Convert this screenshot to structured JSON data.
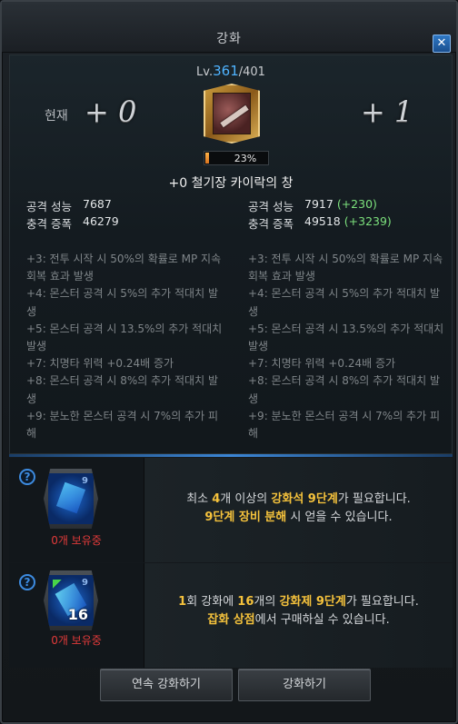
{
  "window": {
    "title": "강화"
  },
  "level": {
    "prefix": "Lv.",
    "current": "361",
    "max": "/401"
  },
  "current_label": "현재",
  "current_plus": "+ 0",
  "next_plus": "+ 1",
  "progress": {
    "percent": 23,
    "label": "23%"
  },
  "item_name": "+0 철기장 카이락의 창",
  "stats_current": [
    {
      "label": "공격 성능",
      "value": "7687",
      "bonus": ""
    },
    {
      "label": "충격 증폭",
      "value": "46279",
      "bonus": ""
    }
  ],
  "stats_next": [
    {
      "label": "공격 성능",
      "value": "7917",
      "bonus": "(+230)"
    },
    {
      "label": "충격 증폭",
      "value": "49518",
      "bonus": "(+3239)"
    }
  ],
  "effects_current": [
    "+3: 전투 시작 시 50%의 확률로 MP 지속 회복 효과 발생",
    "+4: 몬스터 공격 시 5%의 추가 적대치 발생",
    "+5: 몬스터 공격 시 13.5%의 추가 적대치 발생",
    "+7: 치명타 위력 +0.24배 증가",
    "+8: 몬스터 공격 시 8%의 추가 적대치 발생",
    "+9: 분노한 몬스터 공격 시 7%의 추가 피해"
  ],
  "effects_next": [
    "+3: 전투 시작 시 50%의 확률로 MP 지속 회복 효과 발생",
    "+4: 몬스터 공격 시 5%의 추가 적대치 발생",
    "+5: 몬스터 공격 시 13.5%의 추가 적대치 발생",
    "+7: 치명타 위력 +0.24배 증가",
    "+8: 몬스터 공격 시 8%의 추가 적대치 발생",
    "+9: 분노한 몬스터 공격 시 7%의 추가 피해"
  ],
  "requirement_stone": {
    "help": "?",
    "tier": "9",
    "owned": "0개 보유중",
    "line1": {
      "a": "최소 ",
      "count": "4",
      "b": "개 이상의 ",
      "item": "강화석 9단계",
      "c": "가 필요합니다."
    },
    "line2": {
      "hl": "9단계 장비 분해",
      "rest": " 시 얻을 수 있습니다."
    }
  },
  "requirement_agent": {
    "help": "?",
    "tier": "9",
    "count": "16",
    "owned": "0개 보유중",
    "line1": {
      "n": "1",
      "a": "회 강화에 ",
      "count": "16",
      "b": "개의 ",
      "item": "강화제 9단계",
      "c": "가 필요합니다."
    },
    "line2": {
      "hl": "잡화 상점",
      "rest": "에서 구매하실 수 있습니다."
    }
  },
  "buttons": {
    "continuous": "연속 강화하기",
    "enhance": "강화하기"
  },
  "colors": {
    "accent_blue": "#3b85d4",
    "level_blue": "#4fb3ff",
    "highlight_yellow": "#f5c23c",
    "bonus_green": "#7ce07c",
    "warning_red": "#e23a3a"
  }
}
